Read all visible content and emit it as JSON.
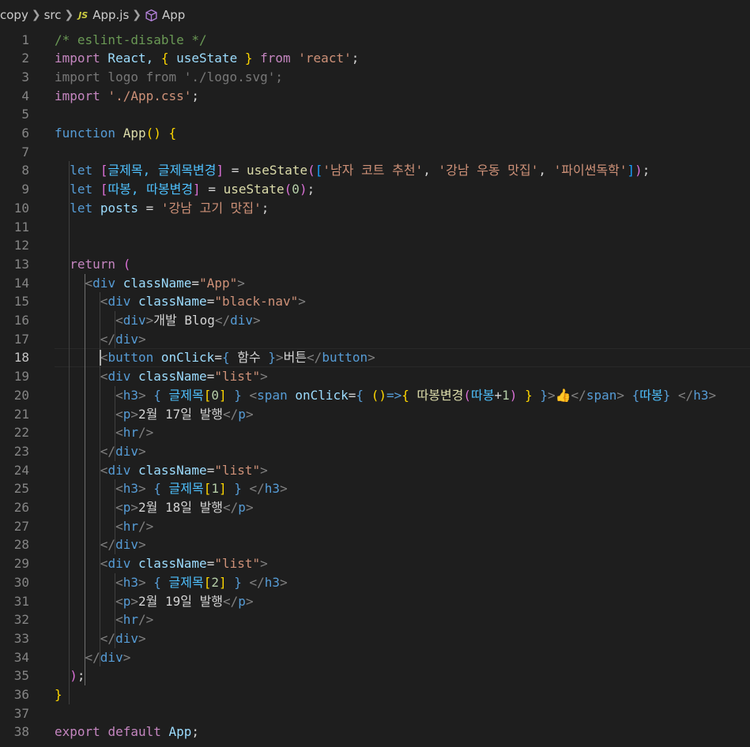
{
  "breadcrumb": {
    "items": [
      "copy",
      "src",
      "App.js",
      "App"
    ],
    "js_badge": "JS"
  },
  "editor": {
    "active_line": 18,
    "lines": [
      [
        [
          "/* eslint-disable */",
          "#6a9955"
        ]
      ],
      [
        [
          "import",
          "#c586c0"
        ],
        [
          " React, ",
          "#9cdcfe"
        ],
        [
          "{",
          "#ffd700"
        ],
        [
          " useState ",
          "#9cdcfe"
        ],
        [
          "}",
          "#ffd700"
        ],
        [
          " from",
          "#c586c0"
        ],
        [
          " ",
          "#d4d4d4"
        ],
        [
          "'react'",
          "#ce9178"
        ],
        [
          ";",
          "#d4d4d4"
        ]
      ],
      [
        [
          "import logo from './logo.svg';",
          "#777777"
        ]
      ],
      [
        [
          "import",
          "#c586c0"
        ],
        [
          " ",
          "#d4d4d4"
        ],
        [
          "'./App.css'",
          "#ce9178"
        ],
        [
          ";",
          "#d4d4d4"
        ]
      ],
      [],
      [
        [
          "function",
          "#569cd6"
        ],
        [
          " ",
          "#d4d4d4"
        ],
        [
          "App",
          "#dcdcaa"
        ],
        [
          "()",
          "#ffd700"
        ],
        [
          " ",
          "#d4d4d4"
        ],
        [
          "{",
          "#ffd700"
        ]
      ],
      [],
      [
        [
          "  ",
          "#d4d4d4"
        ],
        [
          "let",
          "#569cd6"
        ],
        [
          " ",
          "#d4d4d4"
        ],
        [
          "[",
          "#da70d6"
        ],
        [
          "글제목, 글제목변경",
          "#4fc1ff"
        ],
        [
          "]",
          "#da70d6"
        ],
        [
          " = ",
          "#d4d4d4"
        ],
        [
          "useState",
          "#dcdcaa"
        ],
        [
          "(",
          "#da70d6"
        ],
        [
          "[",
          "#179fff"
        ],
        [
          "'남자 코트 추천'",
          "#ce9178"
        ],
        [
          ", ",
          "#d4d4d4"
        ],
        [
          "'강남 우동 맛집'",
          "#ce9178"
        ],
        [
          ", ",
          "#d4d4d4"
        ],
        [
          "'파이썬독학'",
          "#ce9178"
        ],
        [
          "]",
          "#179fff"
        ],
        [
          ")",
          "#da70d6"
        ],
        [
          ";",
          "#d4d4d4"
        ]
      ],
      [
        [
          "  ",
          "#d4d4d4"
        ],
        [
          "let",
          "#569cd6"
        ],
        [
          " ",
          "#d4d4d4"
        ],
        [
          "[",
          "#da70d6"
        ],
        [
          "따봉, 따봉변경",
          "#4fc1ff"
        ],
        [
          "]",
          "#da70d6"
        ],
        [
          " = ",
          "#d4d4d4"
        ],
        [
          "useState",
          "#dcdcaa"
        ],
        [
          "(",
          "#da70d6"
        ],
        [
          "0",
          "#b5cea8"
        ],
        [
          ")",
          "#da70d6"
        ],
        [
          ";",
          "#d4d4d4"
        ]
      ],
      [
        [
          "  ",
          "#d4d4d4"
        ],
        [
          "let",
          "#569cd6"
        ],
        [
          " ",
          "#d4d4d4"
        ],
        [
          "posts",
          "#9cdcfe"
        ],
        [
          " = ",
          "#d4d4d4"
        ],
        [
          "'강남 고기 맛집'",
          "#ce9178"
        ],
        [
          ";",
          "#d4d4d4"
        ]
      ],
      [],
      [],
      [
        [
          "  ",
          "#d4d4d4"
        ],
        [
          "return",
          "#c586c0"
        ],
        [
          " ",
          "#d4d4d4"
        ],
        [
          "(",
          "#da70d6"
        ]
      ],
      [
        [
          "    ",
          "#d4d4d4"
        ],
        [
          "<",
          "#808080"
        ],
        [
          "div",
          "#569cd6"
        ],
        [
          " ",
          "#d4d4d4"
        ],
        [
          "className",
          "#9cdcfe"
        ],
        [
          "=",
          "#d4d4d4"
        ],
        [
          "\"App\"",
          "#ce9178"
        ],
        [
          ">",
          "#808080"
        ]
      ],
      [
        [
          "      ",
          "#d4d4d4"
        ],
        [
          "<",
          "#808080"
        ],
        [
          "div",
          "#569cd6"
        ],
        [
          " ",
          "#d4d4d4"
        ],
        [
          "className",
          "#9cdcfe"
        ],
        [
          "=",
          "#d4d4d4"
        ],
        [
          "\"black-nav\"",
          "#ce9178"
        ],
        [
          ">",
          "#808080"
        ]
      ],
      [
        [
          "        ",
          "#d4d4d4"
        ],
        [
          "<",
          "#808080"
        ],
        [
          "div",
          "#569cd6"
        ],
        [
          ">",
          "#808080"
        ],
        [
          "개발 Blog",
          "#d4d4d4"
        ],
        [
          "</",
          "#808080"
        ],
        [
          "div",
          "#569cd6"
        ],
        [
          ">",
          "#808080"
        ]
      ],
      [
        [
          "      ",
          "#d4d4d4"
        ],
        [
          "</",
          "#808080"
        ],
        [
          "div",
          "#569cd6"
        ],
        [
          ">",
          "#808080"
        ]
      ],
      [
        [
          "      ",
          "#d4d4d4"
        ],
        [
          "<",
          "#808080"
        ],
        [
          "button",
          "#569cd6"
        ],
        [
          " ",
          "#d4d4d4"
        ],
        [
          "onClick",
          "#9cdcfe"
        ],
        [
          "=",
          "#d4d4d4"
        ],
        [
          "{",
          "#569cd6"
        ],
        [
          " 함수 ",
          "#d4d4d4"
        ],
        [
          "}",
          "#569cd6"
        ],
        [
          ">",
          "#808080"
        ],
        [
          "버튼",
          "#d4d4d4"
        ],
        [
          "</",
          "#808080"
        ],
        [
          "button",
          "#569cd6"
        ],
        [
          ">",
          "#808080"
        ]
      ],
      [
        [
          "      ",
          "#d4d4d4"
        ],
        [
          "<",
          "#808080"
        ],
        [
          "div",
          "#569cd6"
        ],
        [
          " ",
          "#d4d4d4"
        ],
        [
          "className",
          "#9cdcfe"
        ],
        [
          "=",
          "#d4d4d4"
        ],
        [
          "\"list\"",
          "#ce9178"
        ],
        [
          ">",
          "#808080"
        ]
      ],
      [
        [
          "        ",
          "#d4d4d4"
        ],
        [
          "<",
          "#808080"
        ],
        [
          "h3",
          "#569cd6"
        ],
        [
          ">",
          "#808080"
        ],
        [
          " ",
          "#d4d4d4"
        ],
        [
          "{",
          "#569cd6"
        ],
        [
          " 글제목",
          "#4fc1ff"
        ],
        [
          "[",
          "#ffd700"
        ],
        [
          "0",
          "#b5cea8"
        ],
        [
          "]",
          "#ffd700"
        ],
        [
          " ",
          "#d4d4d4"
        ],
        [
          "}",
          "#569cd6"
        ],
        [
          " ",
          "#d4d4d4"
        ],
        [
          "<",
          "#808080"
        ],
        [
          "span",
          "#569cd6"
        ],
        [
          " ",
          "#d4d4d4"
        ],
        [
          "onClick",
          "#9cdcfe"
        ],
        [
          "=",
          "#d4d4d4"
        ],
        [
          "{",
          "#569cd6"
        ],
        [
          " ",
          "#d4d4d4"
        ],
        [
          "()",
          "#ffd700"
        ],
        [
          "=>",
          "#569cd6"
        ],
        [
          "{",
          "#ffd700"
        ],
        [
          " ",
          "#d4d4d4"
        ],
        [
          "따봉변경",
          "#dcdcaa"
        ],
        [
          "(",
          "#da70d6"
        ],
        [
          "따봉",
          "#4fc1ff"
        ],
        [
          "+",
          "#d4d4d4"
        ],
        [
          "1",
          "#b5cea8"
        ],
        [
          ")",
          "#da70d6"
        ],
        [
          " ",
          "#d4d4d4"
        ],
        [
          "}",
          "#ffd700"
        ],
        [
          " ",
          "#d4d4d4"
        ],
        [
          "}",
          "#569cd6"
        ],
        [
          ">",
          "#808080"
        ],
        [
          "👍",
          "#e8b64a"
        ],
        [
          "</",
          "#808080"
        ],
        [
          "span",
          "#569cd6"
        ],
        [
          ">",
          "#808080"
        ],
        [
          " ",
          "#d4d4d4"
        ],
        [
          "{",
          "#569cd6"
        ],
        [
          "따봉",
          "#4fc1ff"
        ],
        [
          "}",
          "#569cd6"
        ],
        [
          " ",
          "#d4d4d4"
        ],
        [
          "</",
          "#808080"
        ],
        [
          "h3",
          "#569cd6"
        ],
        [
          ">",
          "#808080"
        ]
      ],
      [
        [
          "        ",
          "#d4d4d4"
        ],
        [
          "<",
          "#808080"
        ],
        [
          "p",
          "#569cd6"
        ],
        [
          ">",
          "#808080"
        ],
        [
          "2월 17일 발행",
          "#d4d4d4"
        ],
        [
          "</",
          "#808080"
        ],
        [
          "p",
          "#569cd6"
        ],
        [
          ">",
          "#808080"
        ]
      ],
      [
        [
          "        ",
          "#d4d4d4"
        ],
        [
          "<",
          "#808080"
        ],
        [
          "hr",
          "#569cd6"
        ],
        [
          "/>",
          "#808080"
        ]
      ],
      [
        [
          "      ",
          "#d4d4d4"
        ],
        [
          "</",
          "#808080"
        ],
        [
          "div",
          "#569cd6"
        ],
        [
          ">",
          "#808080"
        ]
      ],
      [
        [
          "      ",
          "#d4d4d4"
        ],
        [
          "<",
          "#808080"
        ],
        [
          "div",
          "#569cd6"
        ],
        [
          " ",
          "#d4d4d4"
        ],
        [
          "className",
          "#9cdcfe"
        ],
        [
          "=",
          "#d4d4d4"
        ],
        [
          "\"list\"",
          "#ce9178"
        ],
        [
          ">",
          "#808080"
        ]
      ],
      [
        [
          "        ",
          "#d4d4d4"
        ],
        [
          "<",
          "#808080"
        ],
        [
          "h3",
          "#569cd6"
        ],
        [
          ">",
          "#808080"
        ],
        [
          " ",
          "#d4d4d4"
        ],
        [
          "{",
          "#569cd6"
        ],
        [
          " 글제목",
          "#4fc1ff"
        ],
        [
          "[",
          "#ffd700"
        ],
        [
          "1",
          "#b5cea8"
        ],
        [
          "]",
          "#ffd700"
        ],
        [
          " ",
          "#d4d4d4"
        ],
        [
          "}",
          "#569cd6"
        ],
        [
          " ",
          "#d4d4d4"
        ],
        [
          "</",
          "#808080"
        ],
        [
          "h3",
          "#569cd6"
        ],
        [
          ">",
          "#808080"
        ]
      ],
      [
        [
          "        ",
          "#d4d4d4"
        ],
        [
          "<",
          "#808080"
        ],
        [
          "p",
          "#569cd6"
        ],
        [
          ">",
          "#808080"
        ],
        [
          "2월 18일 발행",
          "#d4d4d4"
        ],
        [
          "</",
          "#808080"
        ],
        [
          "p",
          "#569cd6"
        ],
        [
          ">",
          "#808080"
        ]
      ],
      [
        [
          "        ",
          "#d4d4d4"
        ],
        [
          "<",
          "#808080"
        ],
        [
          "hr",
          "#569cd6"
        ],
        [
          "/>",
          "#808080"
        ]
      ],
      [
        [
          "      ",
          "#d4d4d4"
        ],
        [
          "</",
          "#808080"
        ],
        [
          "div",
          "#569cd6"
        ],
        [
          ">",
          "#808080"
        ]
      ],
      [
        [
          "      ",
          "#d4d4d4"
        ],
        [
          "<",
          "#808080"
        ],
        [
          "div",
          "#569cd6"
        ],
        [
          " ",
          "#d4d4d4"
        ],
        [
          "className",
          "#9cdcfe"
        ],
        [
          "=",
          "#d4d4d4"
        ],
        [
          "\"list\"",
          "#ce9178"
        ],
        [
          ">",
          "#808080"
        ]
      ],
      [
        [
          "        ",
          "#d4d4d4"
        ],
        [
          "<",
          "#808080"
        ],
        [
          "h3",
          "#569cd6"
        ],
        [
          ">",
          "#808080"
        ],
        [
          " ",
          "#d4d4d4"
        ],
        [
          "{",
          "#569cd6"
        ],
        [
          " 글제목",
          "#4fc1ff"
        ],
        [
          "[",
          "#ffd700"
        ],
        [
          "2",
          "#b5cea8"
        ],
        [
          "]",
          "#ffd700"
        ],
        [
          " ",
          "#d4d4d4"
        ],
        [
          "}",
          "#569cd6"
        ],
        [
          " ",
          "#d4d4d4"
        ],
        [
          "</",
          "#808080"
        ],
        [
          "h3",
          "#569cd6"
        ],
        [
          ">",
          "#808080"
        ]
      ],
      [
        [
          "        ",
          "#d4d4d4"
        ],
        [
          "<",
          "#808080"
        ],
        [
          "p",
          "#569cd6"
        ],
        [
          ">",
          "#808080"
        ],
        [
          "2월 19일 발행",
          "#d4d4d4"
        ],
        [
          "</",
          "#808080"
        ],
        [
          "p",
          "#569cd6"
        ],
        [
          ">",
          "#808080"
        ]
      ],
      [
        [
          "        ",
          "#d4d4d4"
        ],
        [
          "<",
          "#808080"
        ],
        [
          "hr",
          "#569cd6"
        ],
        [
          "/>",
          "#808080"
        ]
      ],
      [
        [
          "      ",
          "#d4d4d4"
        ],
        [
          "</",
          "#808080"
        ],
        [
          "div",
          "#569cd6"
        ],
        [
          ">",
          "#808080"
        ]
      ],
      [
        [
          "    ",
          "#d4d4d4"
        ],
        [
          "</",
          "#808080"
        ],
        [
          "div",
          "#569cd6"
        ],
        [
          ">",
          "#808080"
        ]
      ],
      [
        [
          "  ",
          "#d4d4d4"
        ],
        [
          ")",
          "#da70d6"
        ],
        [
          ";",
          "#d4d4d4"
        ]
      ],
      [
        [
          "}",
          "#ffd700"
        ]
      ],
      [],
      [
        [
          "export",
          "#c586c0"
        ],
        [
          " ",
          "#d4d4d4"
        ],
        [
          "default",
          "#c586c0"
        ],
        [
          " ",
          "#d4d4d4"
        ],
        [
          "App",
          "#9cdcfe"
        ],
        [
          ";",
          "#d4d4d4"
        ]
      ]
    ]
  }
}
